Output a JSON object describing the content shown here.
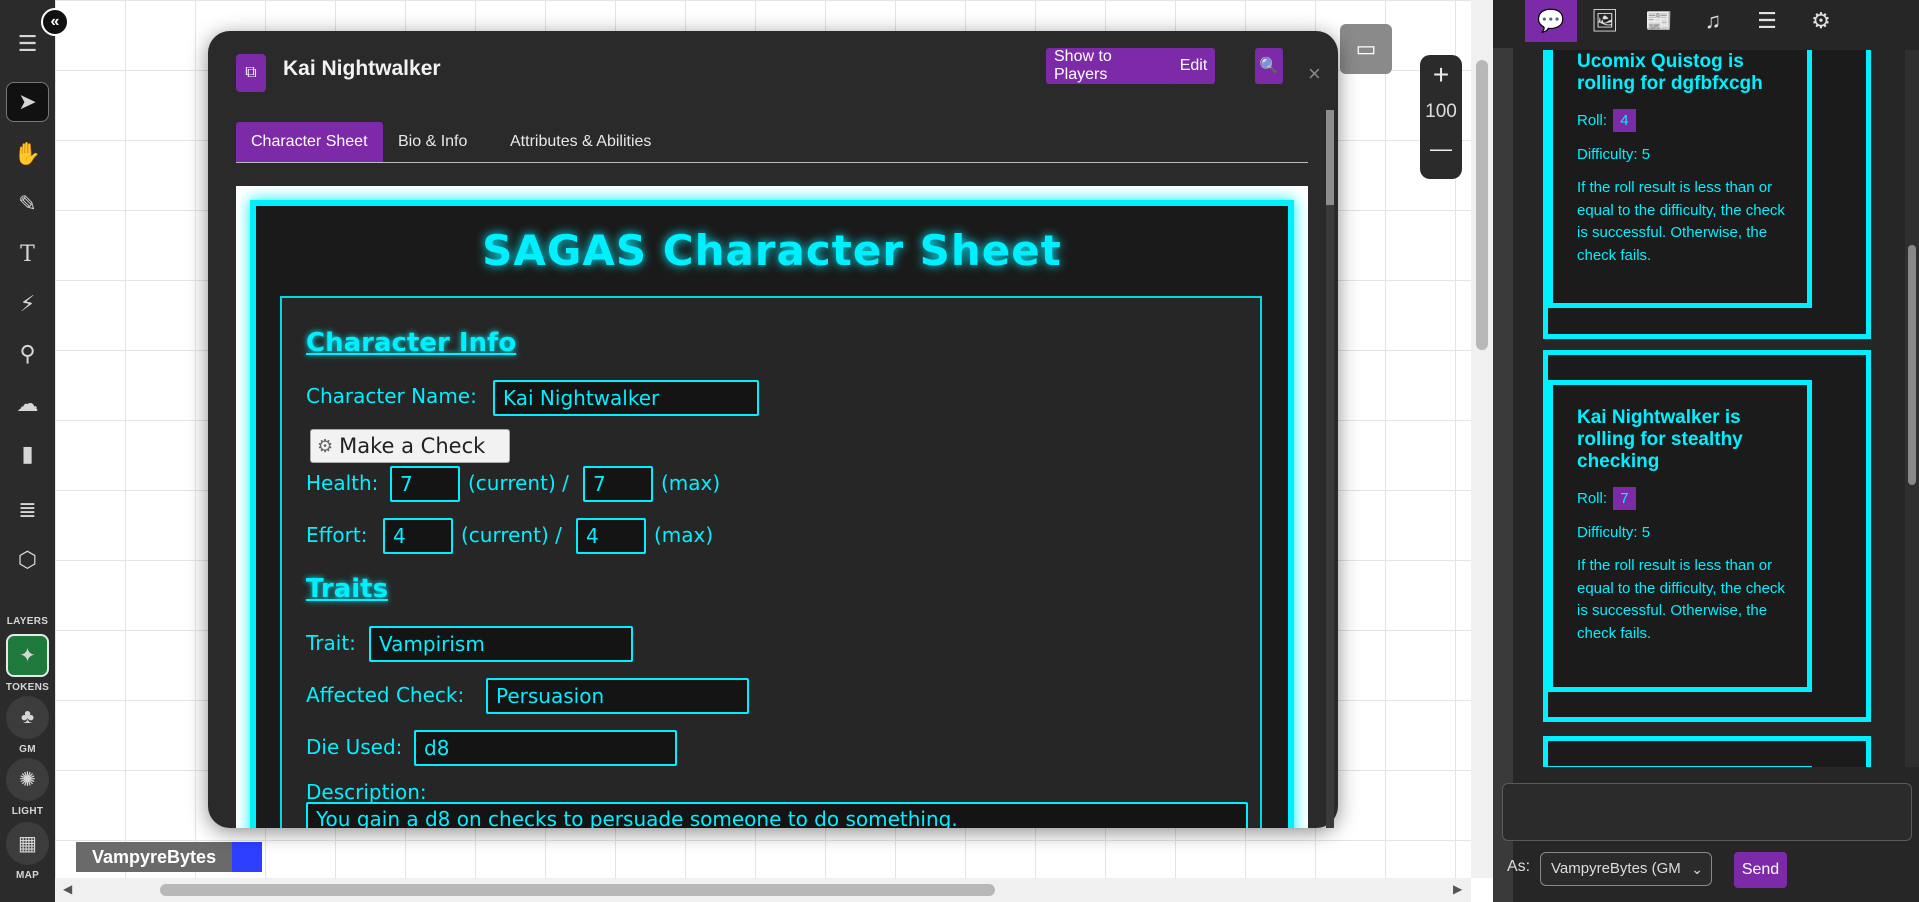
{
  "toolbar": {
    "layers_label": "LAYERS",
    "tokens_label": "TOKENS",
    "gm_label": "GM",
    "light_label": "LIGHT",
    "map_label": "MAP"
  },
  "player": {
    "name": "VampyreBytes",
    "color": "#2f3fff"
  },
  "zoom": {
    "value": "100",
    "plus": "+",
    "minus": "—"
  },
  "dialog": {
    "title": "Kai Nightwalker",
    "show_to_players": "Show to Players",
    "edit": "Edit",
    "close": "×",
    "tabs": [
      "Character Sheet",
      "Bio & Info",
      "Attributes & Abilities"
    ]
  },
  "sheet": {
    "title": "SAGAS Character Sheet",
    "character_info_heading": "Character Info",
    "character_name_label": "Character Name:",
    "character_name_value": "Kai Nightwalker",
    "check_button": "Make a Check",
    "health_label": "Health:",
    "health_current": "7",
    "health_max": "7",
    "current_label": "(current) /",
    "max_label": "(max)",
    "effort_label": "Effort:",
    "effort_current": "4",
    "effort_max": "4",
    "traits_heading": "Traits",
    "trait_label": "Trait:",
    "trait_value": "Vampirism",
    "affected_check_label": "Affected Check:",
    "affected_check_value": "Persuasion",
    "die_used_label": "Die Used:",
    "die_used_value": "d8",
    "description_label": "Description:",
    "description_value": "You gain a d8 on checks to persuade someone to do something."
  },
  "chat": {
    "messages": [
      {
        "title": "Ucomix Quistog is rolling for dgfbfxcgh",
        "roll_label": "Roll:",
        "roll": "4",
        "difficulty": "Difficulty: 5",
        "text": "If the roll result is less than or equal to the difficulty, the check is successful. Otherwise, the check fails."
      },
      {
        "title": "Kai Nightwalker is rolling for stealthy checking",
        "roll_label": "Roll:",
        "roll": "7",
        "difficulty": "Difficulty: 5",
        "text": "If the roll result is less than or equal to the difficulty, the check is successful. Otherwise, the check fails."
      }
    ],
    "as_label": "As:",
    "as_value": "VampyreBytes (GM",
    "send": "Send"
  },
  "colors": {
    "accent": "#7d2aa8",
    "neon": "#00f0ff"
  }
}
